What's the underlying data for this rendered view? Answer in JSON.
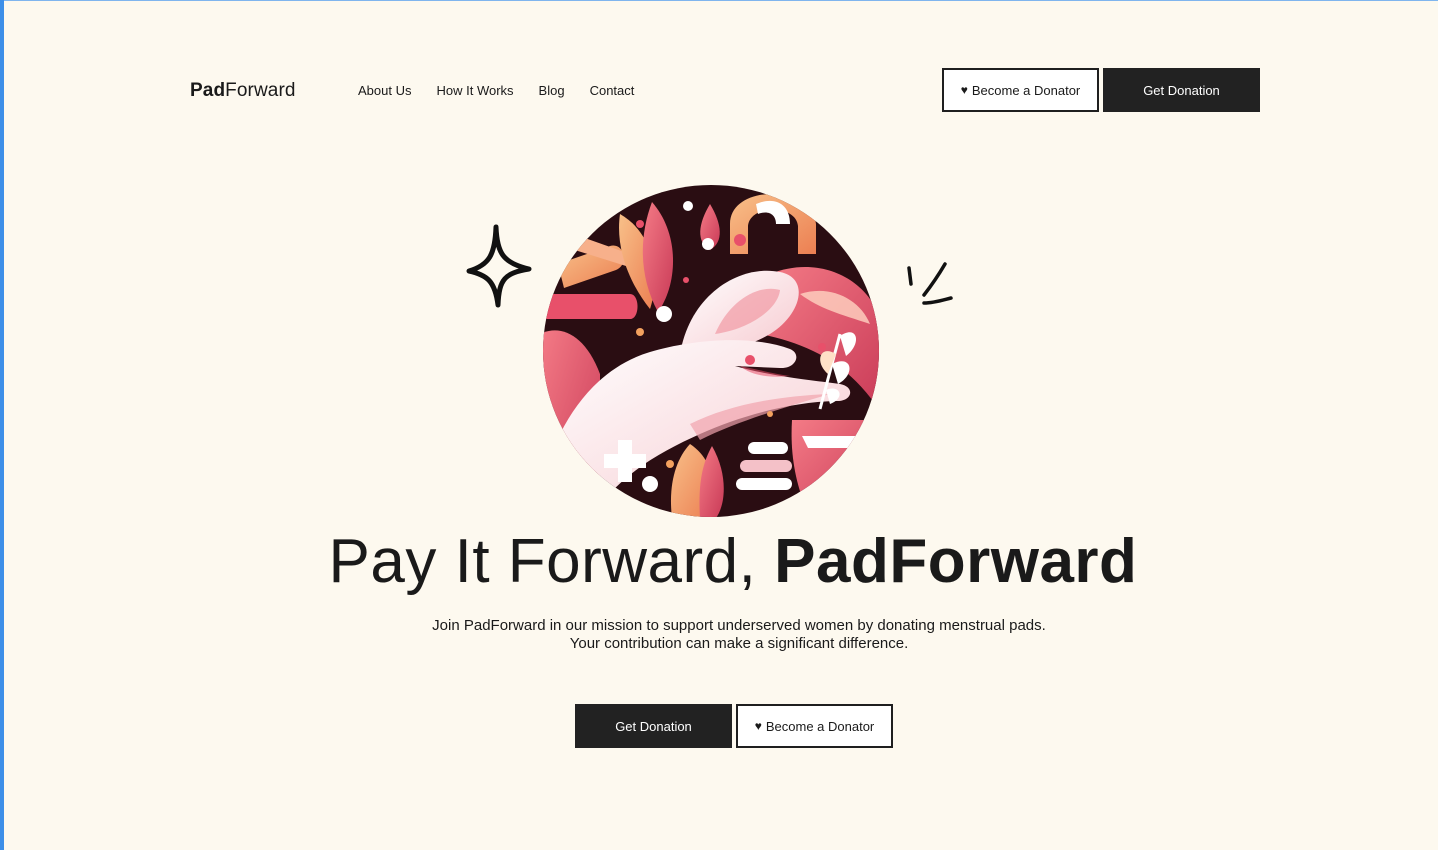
{
  "brand": {
    "name_bold": "Pad",
    "name_light": "Forward"
  },
  "nav": {
    "items": [
      {
        "label": "About Us"
      },
      {
        "label": "How It Works"
      },
      {
        "label": "Blog"
      },
      {
        "label": "Contact"
      }
    ]
  },
  "header": {
    "become_donator_label": "Become a Donator",
    "get_donation_label": "Get Donation"
  },
  "hero": {
    "headline_light": "Pay It Forward,",
    "headline_bold": "PadForward",
    "description_line1": "Join PadForward in our mission to support underserved women by donating menstrual pads.",
    "description_line2": "Your contribution can make a significant difference.",
    "primary_cta_label": "Get Donation",
    "secondary_cta_label": "Become a Donator",
    "illustration_icon": "hand-holding-pad-icon"
  },
  "icons": {
    "heart": "heart-icon",
    "sparkle": "sparkle-icon",
    "strokes": "accent-strokes-icon"
  },
  "colors": {
    "background": "#fdf9ef",
    "button_dark": "#222222",
    "text": "#1a1a1a",
    "accent_pink": "#e8506a",
    "accent_peach": "#f3a15f",
    "accent_dark": "#2a0d12"
  }
}
